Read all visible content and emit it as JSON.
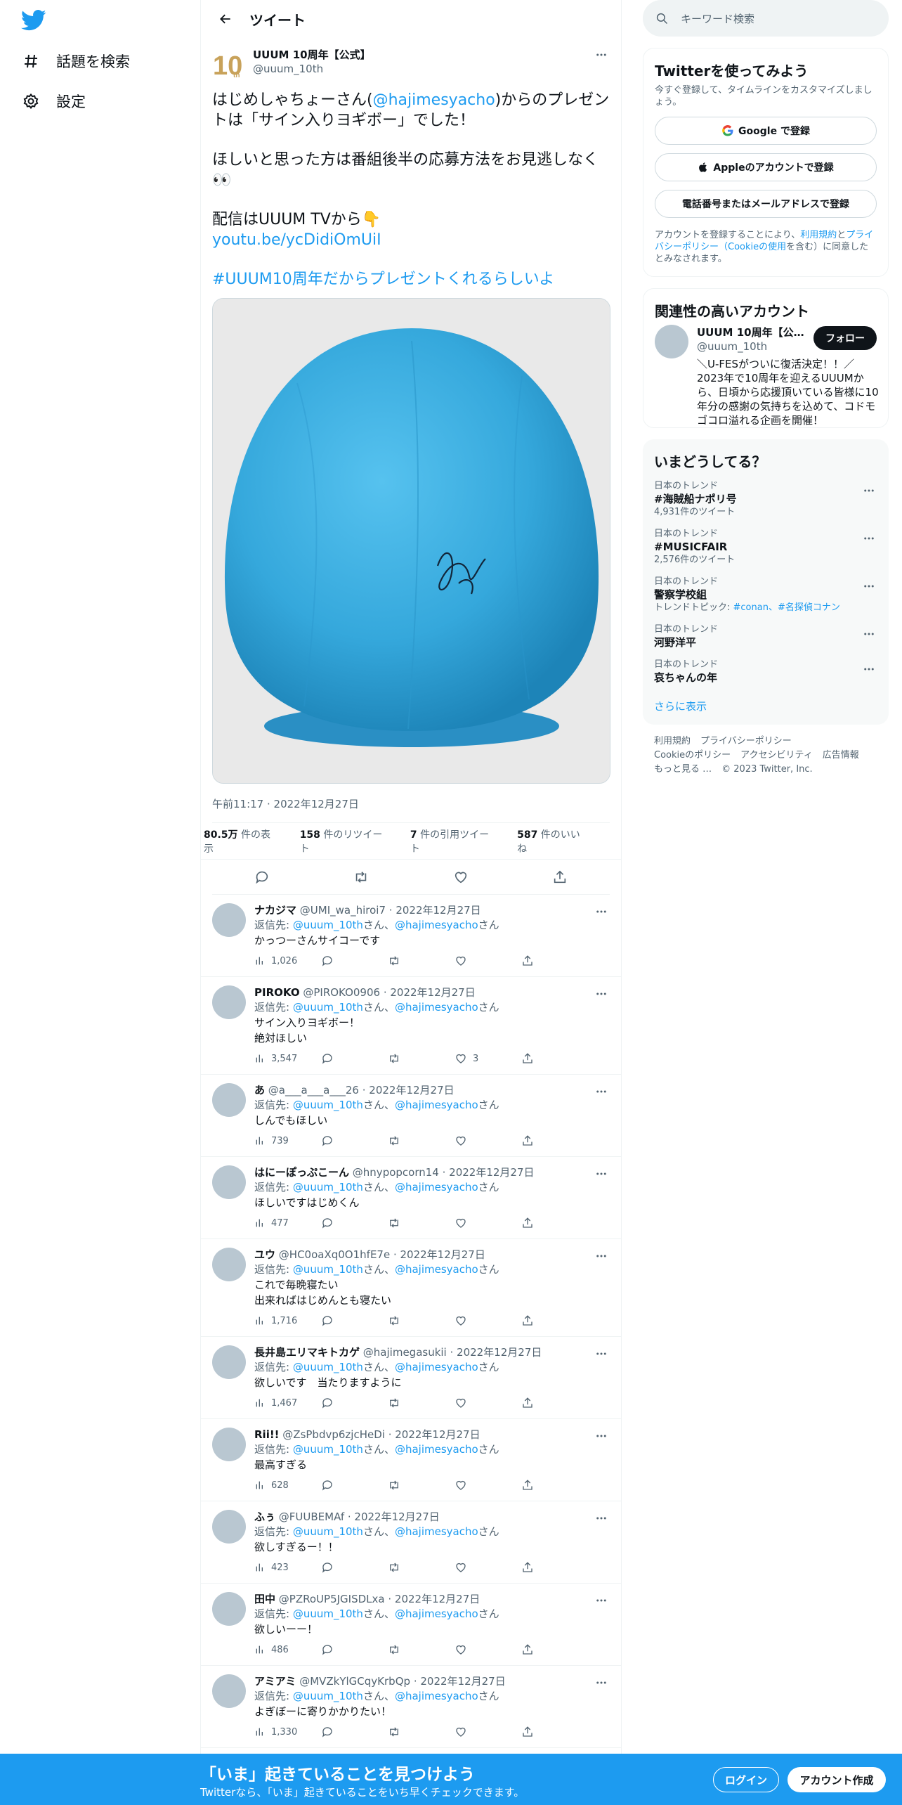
{
  "nav": {
    "explore": "話題を検索",
    "settings": "設定"
  },
  "header": {
    "title": "ツイート"
  },
  "tweet": {
    "name": "UUUM 10周年【公式】",
    "handle": "@uuum_10th",
    "line1_a": "はじめしゃちょーさん(",
    "line1_mention": "@hajimesyacho",
    "line1_b": ")からのプレゼントは「サイン入りヨギボー」でした！",
    "line2": "ほしいと思った方は番組後半の応募方法をお見逃しなく👀",
    "line3": "配信はUUUM TVから👇",
    "link": "youtu.be/ycDidiOmUiI",
    "hashtag": "#UUUM10周年だからプレゼントくれるらしいよ",
    "time": "午前11:17 · 2022年12月27日",
    "views_num": "80.5万",
    "views_label": " 件の表示",
    "retweets_num": "158",
    "retweets_label": " 件のリツイート",
    "quotes_num": "7",
    "quotes_label": " 件の引用ツイート",
    "likes_num": "587",
    "likes_label": " 件のいいね"
  },
  "reply_to_label": "返信先: ",
  "reply_mention1": "@uuum_10th",
  "reply_san1": "さん、",
  "reply_mention2": "@hajimesyacho",
  "reply_san2": "さん",
  "replies": [
    {
      "name": "ナカジマ",
      "handle": "@UMI_wa_hiroi7",
      "date": " · 2022年12月27日",
      "lines": [
        "かっつーさんサイコーです"
      ],
      "views": "1,026",
      "likes": ""
    },
    {
      "name": "PIROKO",
      "handle": "@PIROKO0906",
      "date": " · 2022年12月27日",
      "lines": [
        "サイン入りヨギボー！",
        "絶対ほしい"
      ],
      "views": "3,547",
      "likes": "3"
    },
    {
      "name": "あ",
      "handle": "@a___a___a___26",
      "date": " · 2022年12月27日",
      "lines": [
        "しんでもほしい"
      ],
      "views": "739",
      "likes": ""
    },
    {
      "name": "はにーぽっぷこーん",
      "handle": "@hnypopcorn14",
      "date": " · 2022年12月27日",
      "lines": [
        "ほしいですはじめくん"
      ],
      "views": "477",
      "likes": ""
    },
    {
      "name": "ユウ",
      "handle": "@HC0oaXq0O1hfE7e",
      "date": " · 2022年12月27日",
      "lines": [
        "これで毎晩寝たい",
        "出来ればはじめんとも寝たい"
      ],
      "views": "1,716",
      "likes": ""
    },
    {
      "name": "長井島エリマキトカゲ",
      "handle": "@hajimegasukii",
      "date": " · 2022年12月27日",
      "lines": [
        "欲しいです　当たりますように"
      ],
      "views": "1,467",
      "likes": ""
    },
    {
      "name": "Rii!!",
      "handle": "@ZsPbdvp6zjcHeDi",
      "date": " · 2022年12月27日",
      "lines": [
        "最高すぎる"
      ],
      "views": "628",
      "likes": ""
    },
    {
      "name": "ふぅ",
      "handle": "@FUUBEMAf",
      "date": " · 2022年12月27日",
      "lines": [
        "欲しすぎるー！！"
      ],
      "views": "423",
      "likes": ""
    },
    {
      "name": "田中",
      "handle": "@PZRoUP5JGISDLxa",
      "date": " · 2022年12月27日",
      "lines": [
        "欲しいーー！"
      ],
      "views": "486",
      "likes": ""
    },
    {
      "name": "アミアミ",
      "handle": "@MVZkYlGCqyKrbQp",
      "date": " · 2022年12月27日",
      "lines": [
        "よぎぼーに寄りかかりたい！"
      ],
      "views": "1,330",
      "likes": ""
    }
  ],
  "right": {
    "search_placeholder": "キーワード検索",
    "signup_title": "Twitterを使ってみよう",
    "signup_desc": "今すぐ登録して、タイムラインをカスタマイズしましょう。",
    "google_btn": "Google で登録",
    "apple_btn": "Appleのアカウントで登録",
    "phone_btn": "電話番号またはメールアドレスで登録",
    "legal_a": "アカウントを登録することにより、",
    "legal_terms": "利用規約",
    "legal_b": "と",
    "legal_privacy": "プライバシーポリシー（Cookieの使用",
    "legal_c": "を含む）に同意したとみなされます。",
    "related_title": "関連性の高いアカウント",
    "related_name": "UUUM 10周年【公式…",
    "related_handle": "@uuum_10th",
    "follow_btn": "フォロー",
    "related_bio": "＼U-FESがついに復活決定！！／2023年で10周年を迎えるUUUMから、日頃から応援頂いている皆様に10年分の感謝の気持ちを込めて、コドモゴコロ溢れる企画を開催！",
    "trends_title": "いまどうしてる？",
    "trends": [
      {
        "cat": "日本のトレンド",
        "name": "#海賊船ナポリ号",
        "count": "4,931件のツイート"
      },
      {
        "cat": "日本のトレンド",
        "name": "#MUSICFAIR",
        "count": "2,576件のツイート"
      },
      {
        "cat": "日本のトレンド",
        "name": "警察学校組",
        "count_prefix": "トレンドトピック: ",
        "count_links": "#conan、#名探偵コナン"
      },
      {
        "cat": "日本のトレンド",
        "name": "河野洋平"
      },
      {
        "cat": "日本のトレンド",
        "name": "哀ちゃんの年"
      }
    ],
    "show_more": "さらに表示",
    "footer": [
      "利用規約",
      "プライバシーポリシー",
      "Cookieのポリシー",
      "アクセシビリティ",
      "広告情報",
      "もっと見る …",
      "© 2023 Twitter, Inc."
    ]
  },
  "banner": {
    "title": "「いま」起きていることを見つけよう",
    "sub": "Twitterなら、「いま」起きていることをいち早くチェックできます。",
    "login": "ログイン",
    "signup": "アカウント作成"
  },
  "colors": {
    "accent": "#1d9bf0",
    "text": "#0f1419",
    "muted": "#536471",
    "yogibo": "#3aaee0"
  }
}
